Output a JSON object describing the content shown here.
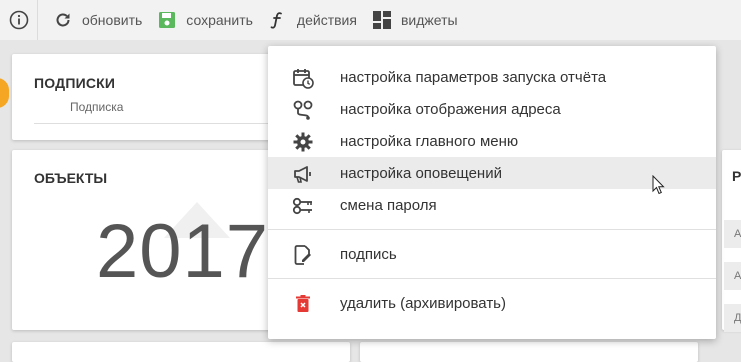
{
  "toolbar": {
    "refresh_label": "обновить",
    "save_label": "сохранить",
    "actions_label": "действия",
    "widgets_label": "виджеты"
  },
  "cards": {
    "subscriptions_title": "ПОДПИСКИ",
    "subscriptions_sub": "Подписка",
    "objects_title": "ОБЪЕКТЫ",
    "objects_value": "2017",
    "right_title": "Р",
    "right_rows": [
      "А",
      "А",
      "Д"
    ]
  },
  "menu": {
    "items": [
      {
        "label": "настройка параметров запуска отчёта",
        "icon": "calendar-clock-icon"
      },
      {
        "label": "настройка отображения адреса",
        "icon": "route-pins-icon"
      },
      {
        "label": "настройка главного меню",
        "icon": "gear-icon"
      },
      {
        "label": "настройка оповещений",
        "icon": "megaphone-icon"
      },
      {
        "label": "смена пароля",
        "icon": "key-icon"
      },
      {
        "label": "подпись",
        "icon": "signature-file-icon"
      },
      {
        "label": "удалить (архивировать)",
        "icon": "trash-icon"
      }
    ]
  },
  "colors": {
    "save_icon": "#5cb85c",
    "delete_icon": "#e53935",
    "orange_accent": "#f5a623"
  }
}
